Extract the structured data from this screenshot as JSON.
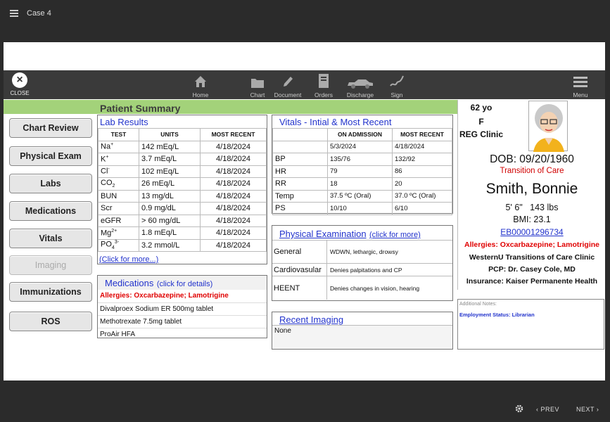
{
  "app": {
    "case_title": "Case 4"
  },
  "toolbar": {
    "close_label": "CLOSE",
    "items": [
      {
        "label": "Home",
        "icon": "home-icon"
      },
      {
        "label": "Chart",
        "icon": "folder-icon"
      },
      {
        "label": "Document",
        "icon": "pencil-icon"
      },
      {
        "label": "Orders",
        "icon": "clipboard-icon"
      },
      {
        "label": "Discharge",
        "icon": "car-icon"
      },
      {
        "label": "Sign",
        "icon": "signature-icon"
      },
      {
        "label": "Menu",
        "icon": "menu-icon"
      }
    ]
  },
  "summary_title": "Patient Summary",
  "nav": [
    {
      "label": "Chart Review",
      "enabled": true
    },
    {
      "label": "Physical Exam",
      "enabled": true
    },
    {
      "label": "Labs",
      "enabled": true
    },
    {
      "label": "Medications",
      "enabled": true
    },
    {
      "label": "Vitals",
      "enabled": true
    },
    {
      "label": "Imaging",
      "enabled": false
    },
    {
      "label": "Immunizations",
      "enabled": true
    },
    {
      "label": "ROS",
      "enabled": true
    }
  ],
  "labs": {
    "title": "Lab Results",
    "headers": [
      "TEST",
      "UNITS",
      "MOST RECENT"
    ],
    "rows": [
      {
        "test": "Na",
        "mark": "+",
        "mark_pos": "sup",
        "units": "142 mEq/L",
        "recent": "4/18/2024"
      },
      {
        "test": "K",
        "mark": "+",
        "mark_pos": "sup",
        "units": "3.7 mEq/L",
        "recent": "4/18/2024"
      },
      {
        "test": "Cl",
        "mark": "-",
        "mark_pos": "sup",
        "units": "102 mEq/L",
        "recent": "4/18/2024"
      },
      {
        "test": "CO",
        "mark": "2",
        "mark_pos": "sub",
        "units": "26 mEq/L",
        "recent": "4/18/2024"
      },
      {
        "test": "BUN",
        "mark": "",
        "mark_pos": "",
        "units": "13 mg/dL",
        "recent": "4/18/2024"
      },
      {
        "test": "Scr",
        "mark": "",
        "mark_pos": "",
        "units": "0.9 mg/dL",
        "recent": "4/18/2024"
      },
      {
        "test": "eGFR",
        "mark": "",
        "mark_pos": "",
        "units": "> 60 mg/dL",
        "recent": "4/18/2024"
      },
      {
        "test": "Mg",
        "mark": "2+",
        "mark_pos": "sup",
        "units": "1.8 mEq/L",
        "recent": "4/18/2024"
      },
      {
        "test": "PO",
        "mark": "4",
        "mark_pos": "sub",
        "mark2": "3-",
        "units": "3.2 mmol/L",
        "recent": "4/18/2024"
      }
    ],
    "more_link": "(Click for more...)"
  },
  "vitals": {
    "title": "Vitals - Intial & Most Recent",
    "headers": [
      "",
      "ON ADMISSION",
      "MOST RECENT"
    ],
    "rows": [
      {
        "name": "",
        "admission": "5/3/2024",
        "recent": "4/18/2024"
      },
      {
        "name": "BP",
        "admission": "135/76",
        "recent": "132/92"
      },
      {
        "name": "HR",
        "admission": "79",
        "recent": "86"
      },
      {
        "name": "RR",
        "admission": "18",
        "recent": "20"
      },
      {
        "name": "Temp",
        "admission": "37.5 ºC  (Oral)",
        "recent": "37.0 ºC  (Oral)"
      },
      {
        "name": "PS",
        "admission": "10/10",
        "recent": "6/10"
      }
    ]
  },
  "physical": {
    "title": "Physical Examination",
    "link": "(click for more)",
    "rows": [
      {
        "name": "General",
        "value": "WDWN, lethargic, drowsy"
      },
      {
        "name": "Cardiovasular",
        "value": "Denies palpitations and CP"
      },
      {
        "name": "HEENT",
        "value": "Denies changes in vision, hearing"
      }
    ]
  },
  "medications": {
    "title": "Medications",
    "link": "(click for details)",
    "allergy": "Allergies: Oxcarbazepine; Lamotrigine",
    "items": [
      "Divalproex Sodium ER 500mg tablet",
      "Methotrexate 7.5mg tablet",
      "ProAir HFA"
    ]
  },
  "imaging": {
    "title": "Recent Imaging",
    "value": "None"
  },
  "patient": {
    "age": "62 yo",
    "sex": "F",
    "clinic": "REG Clinic",
    "dob": "DOB: 09/20/1960",
    "status": "Transition of Care",
    "name": "Smith, Bonnie",
    "height": "5' 6\"",
    "weight": "143 lbs",
    "bmi": "BMI: 23.1",
    "mrn": "EB00001296734",
    "allergies": "Allergies: Oxcarbazepine; Lamotrigine",
    "facility": "WesternU Transitions of Care Clinic",
    "pcp": "PCP: Dr. Casey Cole, MD",
    "insurance": "Insurance: Kaiser Permanente Health"
  },
  "notes": {
    "title": "Additional Notes:",
    "employment": "Employment Status: Librarian"
  },
  "footer": {
    "prev": "PREV",
    "next": "NEXT"
  },
  "colors": {
    "accent_green": "#a3d27a",
    "link_blue": "#2233cc",
    "alert_red": "#e00000"
  }
}
